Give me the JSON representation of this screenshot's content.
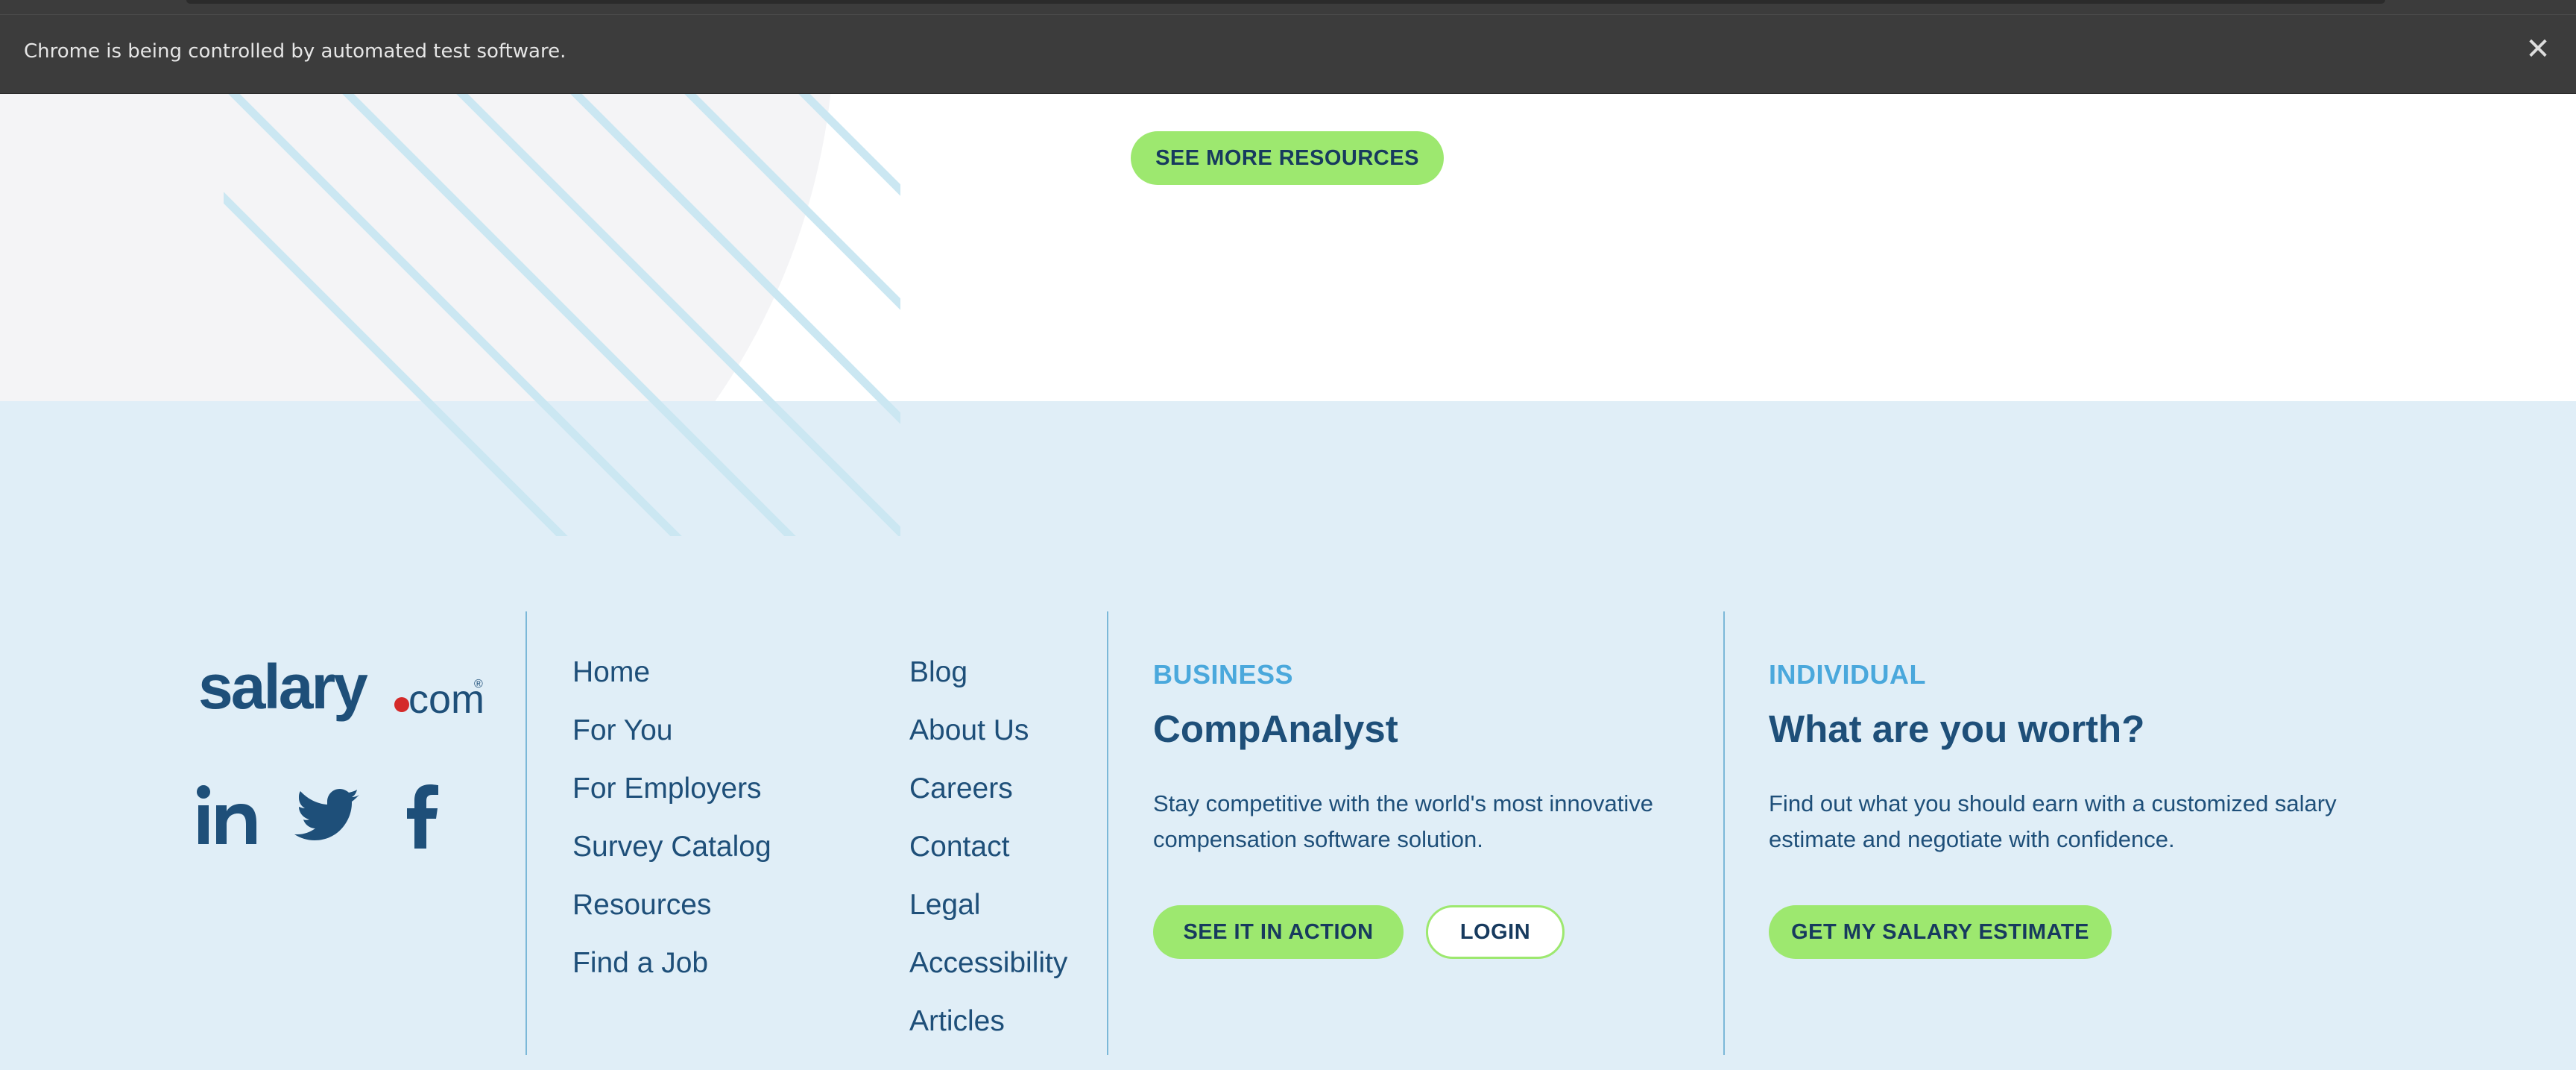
{
  "browser_banner": {
    "message": "Chrome is being controlled by automated test software.",
    "close_icon": "close-icon"
  },
  "resources": {
    "see_more_label": "SEE MORE RESOURCES"
  },
  "footer": {
    "logo": {
      "text": "salary.com",
      "icon": "salary-com-logo"
    },
    "social": [
      {
        "name": "linkedin-icon",
        "label": "in"
      },
      {
        "name": "twitter-icon",
        "label": "twitter"
      },
      {
        "name": "facebook-icon",
        "label": "f"
      }
    ],
    "nav_col1": [
      "Home",
      "For You",
      "For Employers",
      "Survey Catalog",
      "Resources",
      "Find a Job"
    ],
    "nav_col2": [
      "Blog",
      "About Us",
      "Careers",
      "Contact",
      "Legal",
      "Accessibility",
      "Articles"
    ],
    "business": {
      "eyebrow": "BUSINESS",
      "headline": "CompAnalyst",
      "desc_line1": "Stay competitive with the world's most innovative",
      "desc_line2": "compensation software solution.",
      "cta_label": "SEE IT IN ACTION",
      "login_label": "LOGIN"
    },
    "individual": {
      "eyebrow": "INDIVIDUAL",
      "headline": "What are you worth?",
      "desc_line1": "Find out what you should earn with a customized salary",
      "desc_line2": "estimate and negotiate with confidence.",
      "cta_label": "GET MY SALARY ESTIMATE"
    }
  },
  "colors": {
    "accent_green": "#9de86f",
    "footer_bg": "#e0eef7",
    "navy": "#1e4f79",
    "eyebrow_blue": "#4aa8dc",
    "banner_bg": "#3c3c3c"
  }
}
